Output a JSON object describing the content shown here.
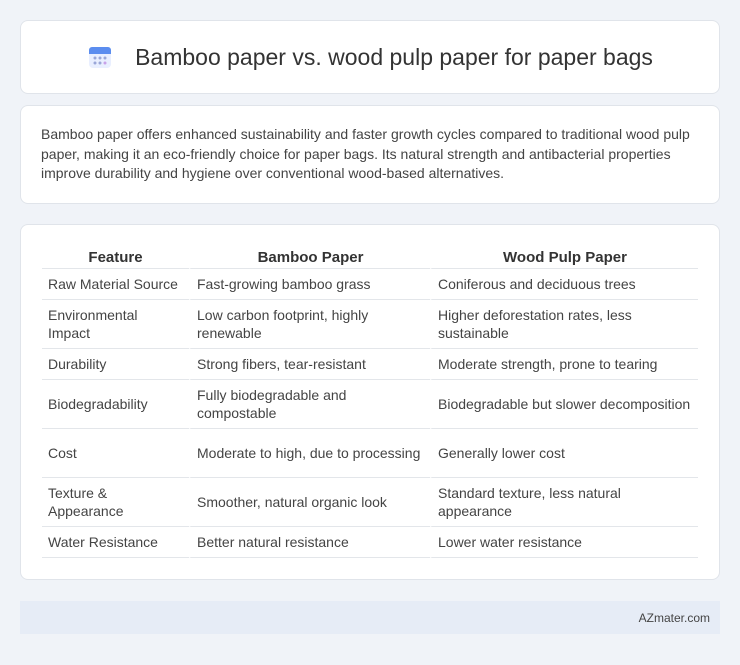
{
  "header": {
    "title": "Bamboo paper vs. wood pulp paper for paper bags",
    "icon": "calendar-icon",
    "icon_color": "#5b8def"
  },
  "summary": {
    "text": "Bamboo paper offers enhanced sustainability and faster growth cycles compared to traditional wood pulp paper, making it an eco-friendly choice for paper bags. Its natural strength and antibacterial properties improve durability and hygiene over conventional wood-based alternatives."
  },
  "table": {
    "headers": [
      "Feature",
      "Bamboo Paper",
      "Wood Pulp Paper"
    ],
    "rows": [
      [
        "Raw Material Source",
        "Fast-growing bamboo grass",
        "Coniferous and deciduous trees"
      ],
      [
        "Environmental Impact",
        "Low carbon footprint, highly renewable",
        "Higher deforestation rates, less sustainable"
      ],
      [
        "Durability",
        "Strong fibers, tear-resistant",
        "Moderate strength, prone to tearing"
      ],
      [
        "Biodegradability",
        "Fully biodegradable and compostable",
        "Biodegradable but slower decomposition"
      ],
      [
        "Cost",
        "Moderate to high, due to processing",
        "Generally lower cost"
      ],
      [
        "Texture & Appearance",
        "Smoother, natural organic look",
        "Standard texture, less natural appearance"
      ],
      [
        "Water Resistance",
        "Better natural resistance",
        "Lower water resistance"
      ]
    ]
  },
  "footer": {
    "text": "AZmater.com"
  }
}
